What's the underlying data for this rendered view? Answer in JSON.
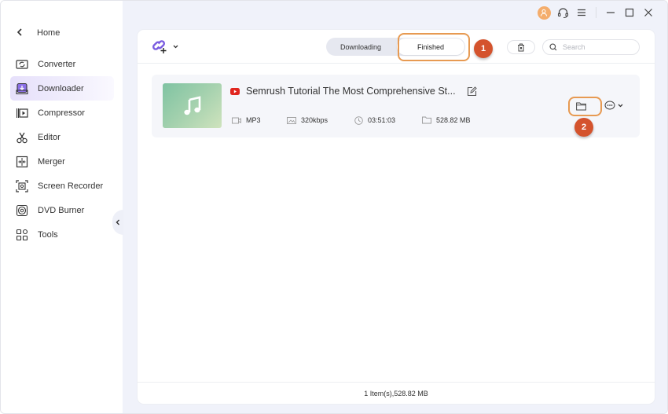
{
  "sidebar": {
    "home_label": "Home",
    "items": [
      {
        "label": "Converter",
        "icon": "converter-icon",
        "active": false
      },
      {
        "label": "Downloader",
        "icon": "downloader-icon",
        "active": true
      },
      {
        "label": "Compressor",
        "icon": "compressor-icon",
        "active": false
      },
      {
        "label": "Editor",
        "icon": "editor-icon",
        "active": false
      },
      {
        "label": "Merger",
        "icon": "merger-icon",
        "active": false
      },
      {
        "label": "Screen Recorder",
        "icon": "screen-recorder-icon",
        "active": false
      },
      {
        "label": "DVD Burner",
        "icon": "dvd-burner-icon",
        "active": false
      },
      {
        "label": "Tools",
        "icon": "tools-icon",
        "active": false
      }
    ]
  },
  "titlebar": {
    "icons": [
      "avatar-icon",
      "headset-icon",
      "menu-icon",
      "minimize-icon",
      "maximize-icon",
      "close-icon"
    ],
    "avatar_color": "#f4ad6c"
  },
  "toolbar": {
    "add_link_icon": "add-link-icon",
    "tabs": [
      {
        "label": "Downloading",
        "active": false
      },
      {
        "label": "Finished",
        "active": true
      }
    ],
    "search_placeholder": "Search",
    "search_value": ""
  },
  "annotations": {
    "badge1": "1",
    "badge2": "2",
    "highlight_color": "#e79a52",
    "badge_color": "#d4532d"
  },
  "items": [
    {
      "title": "Semrush Tutorial The Most Comprehensive St...",
      "source": "youtube",
      "format": "MP3",
      "bitrate": "320kbps",
      "duration": "03:51:03",
      "size": "528.82 MB"
    }
  ],
  "footer": {
    "summary": "1 Item(s),528.82 MB"
  },
  "colors": {
    "accent": "#7a5ce0",
    "youtube_red": "#e0261f"
  }
}
